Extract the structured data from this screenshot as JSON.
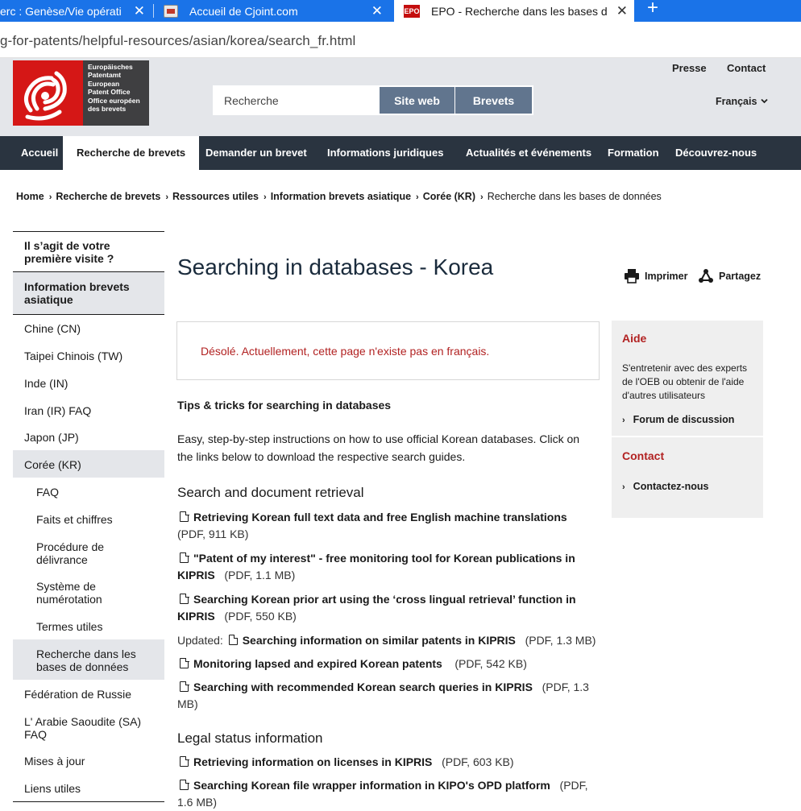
{
  "browser": {
    "tabs": [
      {
        "title": "erc : Genèse/Vie opérati",
        "active": false
      },
      {
        "title": "Accueil de Cjoint.com",
        "active": false
      },
      {
        "title": "EPO - Recherche dans les bases d",
        "active": true
      }
    ],
    "epo_favicon": "EPO",
    "url": "g-for-patents/helpful-resources/asian/korea/search_fr.html"
  },
  "header": {
    "logo_lines": [
      "Europäisches",
      "Patentamt",
      "European",
      "Patent Office",
      "Office européen",
      "des brevets"
    ],
    "search_placeholder": "Recherche",
    "btn_site": "Site web",
    "btn_patents": "Brevets",
    "util_press": "Presse",
    "util_contact": "Contact",
    "language": "Français"
  },
  "nav": [
    "Accueil",
    "Recherche de brevets",
    "Demander un brevet",
    "Informations juridiques",
    "Actualités et événements",
    "Formation",
    "Découvrez-nous"
  ],
  "breadcrumb": [
    "Home",
    "Recherche de brevets",
    "Ressources utiles",
    "Information brevets asiatique",
    "Corée (KR)",
    "Recherche dans les bases de données"
  ],
  "sidebar": [
    "Il s’agit de votre première visite ?",
    "Information brevets asiatique",
    "Chine (CN)",
    "Taipei Chinois (TW)",
    "Inde (IN)",
    "Iran (IR) FAQ",
    "Japon (JP)",
    "Corée (KR)",
    "FAQ",
    "Faits et chiffres",
    "Procédure de délivrance",
    "Système de numérotation",
    "Termes utiles",
    "Recherche dans les bases de données",
    "Fédération de Russie",
    "L' Arabie Saoudite (SA) FAQ",
    "Mises à jour",
    "Liens utiles"
  ],
  "content": {
    "title": "Searching in databases - Korea",
    "print": "Imprimer",
    "share": "Partagez",
    "notice": "Désolé. Actuellement, cette page n'existe pas en français.",
    "tips_heading": "Tips & tricks for searching in databases",
    "intro": "Easy, step-by-step instructions on how to use official Korean databases. Click on the links below to download the respective search guides.",
    "section1": "Search and document retrieval",
    "section2": "Legal status information",
    "docs": [
      {
        "prefix": "",
        "title": "Retrieving Korean full text data and free English machine translations",
        "meta": "(PDF, 911 KB)"
      },
      {
        "prefix": "",
        "title": "\"Patent of my interest\" - free monitoring tool for Korean publications in KIPRIS",
        "meta": "(PDF, 1.1 MB)"
      },
      {
        "prefix": "",
        "title": "Searching Korean prior art using the ‘cross lingual retrieval’ function in KIPRIS",
        "meta": "(PDF, 550 KB)"
      },
      {
        "prefix": "Updated:",
        "title": "Searching information on similar patents in KIPRIS",
        "meta": "(PDF, 1.3 MB)"
      },
      {
        "prefix": "",
        "title": "Monitoring lapsed and expired Korean patents",
        "meta": "(PDF, 542 KB)"
      },
      {
        "prefix": "",
        "title": "Searching with recommended Korean search queries in KIPRIS",
        "meta": "(PDF, 1.3 MB)"
      },
      {
        "prefix": "",
        "title": "Retrieving information on licenses in KIPRIS",
        "meta": "(PDF, 603 KB)"
      },
      {
        "prefix": "",
        "title": "Searching Korean file wrapper information in KIPO's OPD platform",
        "meta": "(PDF, 1.6 MB)"
      }
    ]
  },
  "rail": {
    "aide_heading": "Aide",
    "aide_text": "S'entretenir avec des experts de l'OEB ou obtenir de l'aide d'autres utilisateurs",
    "aide_link": "Forum de discussion",
    "contact_heading": "Contact",
    "contact_link": "Contactez-nous"
  }
}
